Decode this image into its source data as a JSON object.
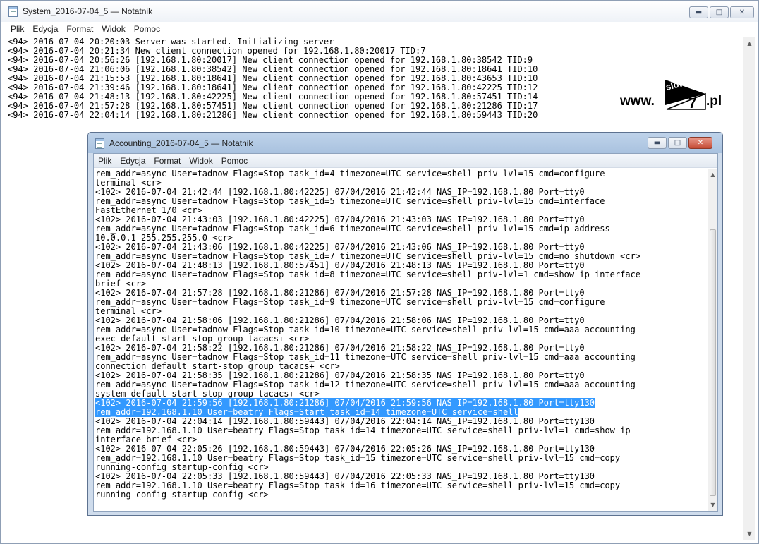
{
  "outer_window": {
    "title": "System_2016-07-04_5 — Notatnik",
    "menu": [
      "Plik",
      "Edycja",
      "Format",
      "Widok",
      "Pomoc"
    ],
    "lines": [
      "<94> 2016-07-04 20:20:03 Server was started. Initializing server",
      "<94> 2016-07-04 20:21:34 New client connection opened for 192.168.1.80:20017 TID:7",
      "<94> 2016-07-04 20:56:26 [192.168.1.80:20017] New client connection opened for 192.168.1.80:38542 TID:9",
      "<94> 2016-07-04 21:06:06 [192.168.1.80:38542] New client connection opened for 192.168.1.80:18641 TID:10",
      "<94> 2016-07-04 21:15:53 [192.168.1.80:18641] New client connection opened for 192.168.1.80:43653 TID:10",
      "<94> 2016-07-04 21:39:46 [192.168.1.80:18641] New client connection opened for 192.168.1.80:42225 TID:12",
      "<94> 2016-07-04 21:48:13 [192.168.1.80:42225] New client connection opened for 192.168.1.80:57451 TID:14",
      "<94> 2016-07-04 21:57:28 [192.168.1.80:57451] New client connection opened for 192.168.1.80:21286 TID:17",
      "<94> 2016-07-04 22:04:14 [192.168.1.80:21286] New client connection opened for 192.168.1.80:59443 TID:20"
    ]
  },
  "logo": {
    "www": "www.",
    "brand": "slow",
    "number": "7",
    "tld": ".pl"
  },
  "inner_window": {
    "title": "Accounting_2016-07-04_5 — Notatnik",
    "menu": [
      "Plik",
      "Edycja",
      "Format",
      "Widok",
      "Pomoc"
    ],
    "lines": [
      {
        "text": "rem_addr=async User=tadnow Flags=Stop task_id=4 timezone=UTC service=shell priv-lvl=15 cmd=configure",
        "selected": false
      },
      {
        "text": "terminal <cr>",
        "selected": false
      },
      {
        "text": "<102> 2016-07-04 21:42:44 [192.168.1.80:42225] 07/04/2016 21:42:44 NAS_IP=192.168.1.80 Port=tty0",
        "selected": false
      },
      {
        "text": "rem_addr=async User=tadnow Flags=Stop task_id=5 timezone=UTC service=shell priv-lvl=15 cmd=interface",
        "selected": false
      },
      {
        "text": "FastEthernet 1/0 <cr>",
        "selected": false
      },
      {
        "text": "<102> 2016-07-04 21:43:03 [192.168.1.80:42225] 07/04/2016 21:43:03 NAS_IP=192.168.1.80 Port=tty0",
        "selected": false
      },
      {
        "text": "rem_addr=async User=tadnow Flags=Stop task_id=6 timezone=UTC service=shell priv-lvl=15 cmd=ip address",
        "selected": false
      },
      {
        "text": "10.0.0.1 255.255.255.0 <cr>",
        "selected": false
      },
      {
        "text": "<102> 2016-07-04 21:43:06 [192.168.1.80:42225] 07/04/2016 21:43:06 NAS_IP=192.168.1.80 Port=tty0",
        "selected": false
      },
      {
        "text": "rem_addr=async User=tadnow Flags=Stop task_id=7 timezone=UTC service=shell priv-lvl=15 cmd=no shutdown <cr>",
        "selected": false
      },
      {
        "text": "<102> 2016-07-04 21:48:13 [192.168.1.80:57451] 07/04/2016 21:48:13 NAS_IP=192.168.1.80 Port=tty0",
        "selected": false
      },
      {
        "text": "rem_addr=async User=tadnow Flags=Stop task_id=8 timezone=UTC service=shell priv-lvl=1 cmd=show ip interface",
        "selected": false
      },
      {
        "text": "brief <cr>",
        "selected": false
      },
      {
        "text": "<102> 2016-07-04 21:57:28 [192.168.1.80:21286] 07/04/2016 21:57:28 NAS_IP=192.168.1.80 Port=tty0",
        "selected": false
      },
      {
        "text": "rem_addr=async User=tadnow Flags=Stop task_id=9 timezone=UTC service=shell priv-lvl=15 cmd=configure",
        "selected": false
      },
      {
        "text": "terminal <cr>",
        "selected": false
      },
      {
        "text": "<102> 2016-07-04 21:58:06 [192.168.1.80:21286] 07/04/2016 21:58:06 NAS_IP=192.168.1.80 Port=tty0",
        "selected": false
      },
      {
        "text": "rem_addr=async User=tadnow Flags=Stop task_id=10 timezone=UTC service=shell priv-lvl=15 cmd=aaa accounting",
        "selected": false
      },
      {
        "text": "exec default start-stop group tacacs+ <cr>",
        "selected": false
      },
      {
        "text": "<102> 2016-07-04 21:58:22 [192.168.1.80:21286] 07/04/2016 21:58:22 NAS_IP=192.168.1.80 Port=tty0",
        "selected": false
      },
      {
        "text": "rem_addr=async User=tadnow Flags=Stop task_id=11 timezone=UTC service=shell priv-lvl=15 cmd=aaa accounting",
        "selected": false
      },
      {
        "text": "connection default start-stop group tacacs+ <cr>",
        "selected": false
      },
      {
        "text": "<102> 2016-07-04 21:58:35 [192.168.1.80:21286] 07/04/2016 21:58:35 NAS_IP=192.168.1.80 Port=tty0",
        "selected": false
      },
      {
        "text": "rem_addr=async User=tadnow Flags=Stop task_id=12 timezone=UTC service=shell priv-lvl=15 cmd=aaa accounting",
        "selected": false
      },
      {
        "text": "system default start-stop group tacacs+ <cr>",
        "selected": false
      },
      {
        "text": "<102> 2016-07-04 21:59:56 [192.168.1.80:21286] 07/04/2016 21:59:56 NAS_IP=192.168.1.80 Port=tty130",
        "selected": true
      },
      {
        "text": "rem_addr=192.168.1.10 User=beatry Flags=Start task_id=14 timezone=UTC service=shell",
        "selected": true
      },
      {
        "text": "<102> 2016-07-04 22:04:14 [192.168.1.80:59443] 07/04/2016 22:04:14 NAS_IP=192.168.1.80 Port=tty130",
        "selected": false
      },
      {
        "text": "rem_addr=192.168.1.10 User=beatry Flags=Stop task_id=14 timezone=UTC service=shell priv-lvl=1 cmd=show ip",
        "selected": false
      },
      {
        "text": "interface brief <cr>",
        "selected": false
      },
      {
        "text": "<102> 2016-07-04 22:05:26 [192.168.1.80:59443] 07/04/2016 22:05:26 NAS_IP=192.168.1.80 Port=tty130",
        "selected": false
      },
      {
        "text": "rem_addr=192.168.1.10 User=beatry Flags=Stop task_id=15 timezone=UTC service=shell priv-lvl=15 cmd=copy",
        "selected": false
      },
      {
        "text": "running-config startup-config <cr>",
        "selected": false
      },
      {
        "text": "<102> 2016-07-04 22:05:33 [192.168.1.80:59443] 07/04/2016 22:05:33 NAS_IP=192.168.1.80 Port=tty130",
        "selected": false
      },
      {
        "text": "rem_addr=192.168.1.10 User=beatry Flags=Stop task_id=16 timezone=UTC service=shell priv-lvl=15 cmd=copy",
        "selected": false
      },
      {
        "text": "running-config startup-config <cr>",
        "selected": false
      }
    ]
  },
  "colors": {
    "selection": "#3399ff",
    "close_button": "#c54c36"
  },
  "icons": {
    "minimize": "minimize-icon",
    "maximize": "maximize-icon",
    "close": "close-icon",
    "notepad": "notepad-icon"
  }
}
